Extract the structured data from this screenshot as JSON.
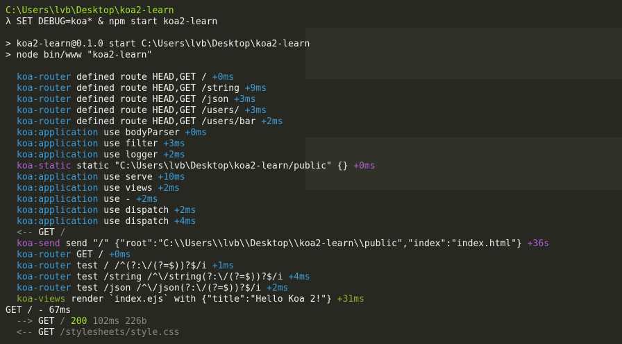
{
  "colors": {
    "background": "#272822",
    "path": "#a6e22e",
    "router": "#3b9bd8",
    "static": "#ae5fd0",
    "views": "#8aab2e",
    "gray": "#8a8a82",
    "plain": "#f0f0ea"
  },
  "lines": [
    {
      "indent": false,
      "segs": [
        {
          "t": "C:\\Users\\lvb\\Desktop\\koa2-learn",
          "c": "path"
        }
      ]
    },
    {
      "indent": false,
      "segs": [
        {
          "t": "λ SET DEBUG=koa* & npm start koa2-learn",
          "c": "plain"
        }
      ]
    },
    {
      "indent": false,
      "segs": [
        {
          "t": "",
          "c": "plain"
        }
      ]
    },
    {
      "indent": false,
      "segs": [
        {
          "t": "> koa2-learn@0.1.0 start C:\\Users\\lvb\\Desktop\\koa2-learn",
          "c": "plain"
        }
      ]
    },
    {
      "indent": false,
      "segs": [
        {
          "t": "> node bin/www \"koa2-learn\"",
          "c": "plain"
        }
      ]
    },
    {
      "indent": false,
      "segs": [
        {
          "t": "",
          "c": "plain"
        }
      ]
    },
    {
      "indent": true,
      "segs": [
        {
          "t": "koa-router",
          "c": "router"
        },
        {
          "t": " defined route HEAD,GET / ",
          "c": "plain"
        },
        {
          "t": "+0ms",
          "c": "timing-blue"
        }
      ]
    },
    {
      "indent": true,
      "segs": [
        {
          "t": "koa-router",
          "c": "router"
        },
        {
          "t": " defined route HEAD,GET /string ",
          "c": "plain"
        },
        {
          "t": "+9ms",
          "c": "timing-blue"
        }
      ]
    },
    {
      "indent": true,
      "segs": [
        {
          "t": "koa-router",
          "c": "router"
        },
        {
          "t": " defined route HEAD,GET /json ",
          "c": "plain"
        },
        {
          "t": "+3ms",
          "c": "timing-blue"
        }
      ]
    },
    {
      "indent": true,
      "segs": [
        {
          "t": "koa-router",
          "c": "router"
        },
        {
          "t": " defined route HEAD,GET /users/ ",
          "c": "plain"
        },
        {
          "t": "+3ms",
          "c": "timing-blue"
        }
      ]
    },
    {
      "indent": true,
      "segs": [
        {
          "t": "koa-router",
          "c": "router"
        },
        {
          "t": " defined route HEAD,GET /users/bar ",
          "c": "plain"
        },
        {
          "t": "+2ms",
          "c": "timing-blue"
        }
      ]
    },
    {
      "indent": true,
      "segs": [
        {
          "t": "koa:application",
          "c": "app"
        },
        {
          "t": " use bodyParser ",
          "c": "plain"
        },
        {
          "t": "+0ms",
          "c": "timing-blue"
        }
      ]
    },
    {
      "indent": true,
      "segs": [
        {
          "t": "koa:application",
          "c": "app"
        },
        {
          "t": " use filter ",
          "c": "plain"
        },
        {
          "t": "+3ms",
          "c": "timing-blue"
        }
      ]
    },
    {
      "indent": true,
      "segs": [
        {
          "t": "koa:application",
          "c": "app"
        },
        {
          "t": " use logger ",
          "c": "plain"
        },
        {
          "t": "+2ms",
          "c": "timing-blue"
        }
      ]
    },
    {
      "indent": true,
      "segs": [
        {
          "t": "koa-static",
          "c": "static"
        },
        {
          "t": " static \"C:\\Users\\lvb\\Desktop\\koa2-learn/public\" {} ",
          "c": "plain"
        },
        {
          "t": "+0ms",
          "c": "timing-purple"
        }
      ]
    },
    {
      "indent": true,
      "segs": [
        {
          "t": "koa:application",
          "c": "app"
        },
        {
          "t": " use serve ",
          "c": "plain"
        },
        {
          "t": "+10ms",
          "c": "timing-blue"
        }
      ]
    },
    {
      "indent": true,
      "segs": [
        {
          "t": "koa:application",
          "c": "app"
        },
        {
          "t": " use views ",
          "c": "plain"
        },
        {
          "t": "+2ms",
          "c": "timing-blue"
        }
      ]
    },
    {
      "indent": true,
      "segs": [
        {
          "t": "koa:application",
          "c": "app"
        },
        {
          "t": " use - ",
          "c": "plain"
        },
        {
          "t": "+2ms",
          "c": "timing-blue"
        }
      ]
    },
    {
      "indent": true,
      "segs": [
        {
          "t": "koa:application",
          "c": "app"
        },
        {
          "t": " use dispatch ",
          "c": "plain"
        },
        {
          "t": "+2ms",
          "c": "timing-blue"
        }
      ]
    },
    {
      "indent": true,
      "segs": [
        {
          "t": "koa:application",
          "c": "app"
        },
        {
          "t": " use dispatch ",
          "c": "plain"
        },
        {
          "t": "+4ms",
          "c": "timing-blue"
        }
      ]
    },
    {
      "indent": true,
      "segs": [
        {
          "t": "<-- ",
          "c": "gray"
        },
        {
          "t": "GET",
          "c": "plain"
        },
        {
          "t": " /",
          "c": "gray"
        }
      ]
    },
    {
      "indent": true,
      "segs": [
        {
          "t": "koa-send",
          "c": "send"
        },
        {
          "t": " send \"/\" {\"root\":\"C:\\\\Users\\\\lvb\\\\Desktop\\\\koa2-learn\\\\public\",\"index\":\"index.html\"} ",
          "c": "plain"
        },
        {
          "t": "+36s",
          "c": "timing-purple"
        }
      ]
    },
    {
      "indent": true,
      "segs": [
        {
          "t": "koa-router",
          "c": "router"
        },
        {
          "t": " GET / ",
          "c": "plain"
        },
        {
          "t": "+0ms",
          "c": "timing-blue"
        }
      ]
    },
    {
      "indent": true,
      "segs": [
        {
          "t": "koa-router",
          "c": "router"
        },
        {
          "t": " test / /^(?:\\/(?=$))?$/i ",
          "c": "plain"
        },
        {
          "t": "+1ms",
          "c": "timing-blue"
        }
      ]
    },
    {
      "indent": true,
      "segs": [
        {
          "t": "koa-router",
          "c": "router"
        },
        {
          "t": " test /string /^\\/string(?:\\/(?=$))?$/i ",
          "c": "plain"
        },
        {
          "t": "+4ms",
          "c": "timing-blue"
        }
      ]
    },
    {
      "indent": true,
      "segs": [
        {
          "t": "koa-router",
          "c": "router"
        },
        {
          "t": " test /json /^\\/json(?:\\/(?=$))?$/i ",
          "c": "plain"
        },
        {
          "t": "+2ms",
          "c": "timing-blue"
        }
      ]
    },
    {
      "indent": true,
      "segs": [
        {
          "t": "koa-views",
          "c": "views"
        },
        {
          "t": " render `index.ejs` with {\"title\":\"Hello Koa 2!\"} ",
          "c": "plain"
        },
        {
          "t": "+31ms",
          "c": "timing-green"
        }
      ]
    },
    {
      "indent": false,
      "segs": [
        {
          "t": "GET / - 67ms",
          "c": "plain"
        }
      ]
    },
    {
      "indent": false,
      "segs": [
        {
          "t": "  --> ",
          "c": "gray"
        },
        {
          "t": "GET",
          "c": "plain"
        },
        {
          "t": " / ",
          "c": "gray"
        },
        {
          "t": "200",
          "c": "status"
        },
        {
          "t": " 102ms 226b",
          "c": "gray"
        }
      ]
    },
    {
      "indent": false,
      "segs": [
        {
          "t": "  <-- ",
          "c": "gray"
        },
        {
          "t": "GET",
          "c": "plain"
        },
        {
          "t": " /stylesheets/style.css",
          "c": "gray"
        }
      ]
    }
  ]
}
